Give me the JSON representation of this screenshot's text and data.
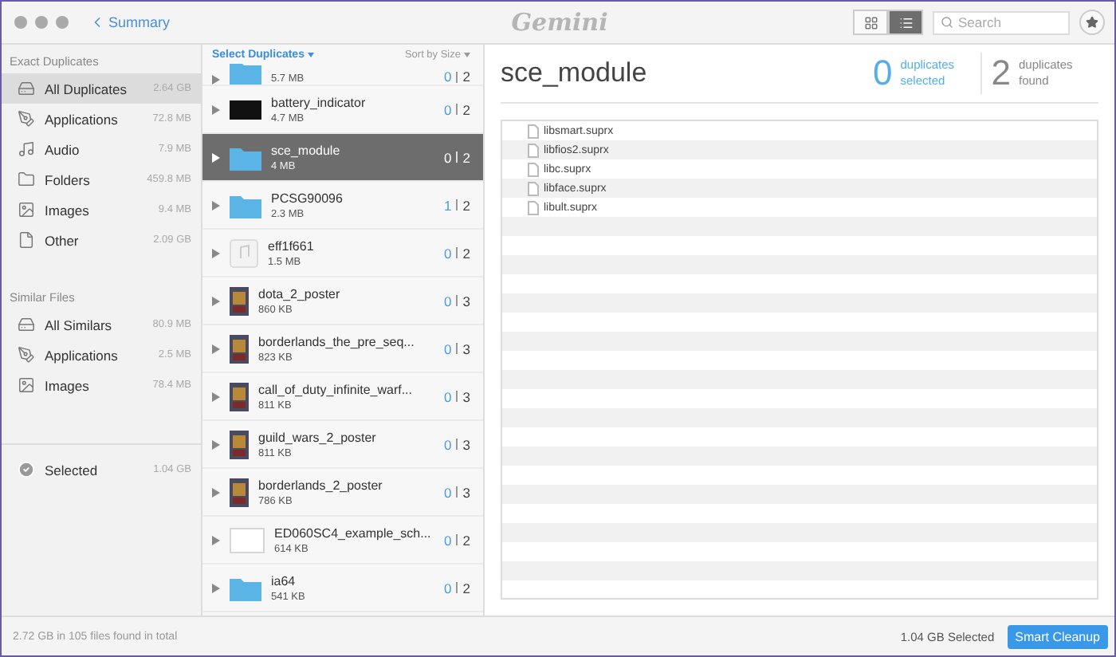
{
  "window": {
    "back": "Summary",
    "logo": "Gemini"
  },
  "toolbar": {
    "views": [
      {
        "kind": "grid",
        "selected": false
      },
      {
        "kind": "list",
        "selected": true
      }
    ],
    "search": {
      "placeholder": "Search"
    }
  },
  "sidebar": {
    "sections": [
      {
        "title": "Exact Duplicates",
        "items": [
          {
            "kind": "drive",
            "label": "All Duplicates",
            "size": "2.64 GB",
            "selected": true
          },
          {
            "kind": "apps",
            "label": "Applications",
            "size": "72.8 MB",
            "selected": false
          },
          {
            "kind": "audio",
            "label": "Audio",
            "size": "7.9 MB",
            "selected": false
          },
          {
            "kind": "folder",
            "label": "Folders",
            "size": "459.8 MB",
            "selected": false
          },
          {
            "kind": "images",
            "label": "Images",
            "size": "9.4 MB",
            "selected": false
          },
          {
            "kind": "other",
            "label": "Other",
            "size": "2.09 GB",
            "selected": false
          }
        ]
      },
      {
        "title": "Similar Files",
        "items": [
          {
            "kind": "drive",
            "label": "All Similars",
            "size": "80.9 MB",
            "selected": false
          },
          {
            "kind": "apps",
            "label": "Applications",
            "size": "2.5 MB",
            "selected": false
          },
          {
            "kind": "images",
            "label": "Images",
            "size": "78.4 MB",
            "selected": false
          }
        ]
      }
    ],
    "selected": {
      "label": "Selected",
      "size": "1.04 GB"
    }
  },
  "list": {
    "select": "Select Duplicates",
    "sort": "Sort by Size",
    "rows": [
      {
        "kind": "folder",
        "size": "5.7 MB",
        "count": "0",
        "total": "2",
        "selected": false
      },
      {
        "kind": "dark",
        "name": "battery_indicator",
        "size": "4.7 MB",
        "count": "0",
        "total": "2",
        "selected": false
      },
      {
        "kind": "folder",
        "name": "sce_module",
        "size": "4 MB",
        "count": "0",
        "total": "2",
        "selected": true
      },
      {
        "kind": "folder",
        "name": "PCSG90096",
        "size": "2.3 MB",
        "count": "1",
        "total": "2",
        "selected": false
      },
      {
        "kind": "music",
        "name": "eff1f661",
        "size": "1.5 MB",
        "count": "0",
        "total": "2",
        "selected": false
      },
      {
        "kind": "poster",
        "name": "dota_2_poster",
        "size": "860 KB",
        "count": "0",
        "total": "3",
        "selected": false
      },
      {
        "kind": "poster",
        "name": "borderlands_the_pre_seq...",
        "size": "823 KB",
        "count": "0",
        "total": "3",
        "selected": false
      },
      {
        "kind": "poster",
        "name": "call_of_duty_infinite_warf...",
        "size": "811 KB",
        "count": "0",
        "total": "3",
        "selected": false
      },
      {
        "kind": "poster",
        "name": "guild_wars_2_poster",
        "size": "811 KB",
        "count": "0",
        "total": "3",
        "selected": false
      },
      {
        "kind": "poster",
        "name": "borderlands_2_poster",
        "size": "786 KB",
        "count": "0",
        "total": "3",
        "selected": false
      },
      {
        "kind": "blank",
        "name": "ED060SC4_example_sch...",
        "size": "614 KB",
        "count": "0",
        "total": "2",
        "selected": false
      },
      {
        "kind": "folder",
        "name": "ia64",
        "size": "541 KB",
        "count": "0",
        "total": "2",
        "selected": false
      }
    ]
  },
  "detail": {
    "title": "sce_module",
    "stats": [
      {
        "kind": "selected",
        "number": "0",
        "label": "duplicates selected"
      },
      {
        "kind": "found",
        "number": "2",
        "label": "duplicates found"
      }
    ],
    "files": [
      "libsmart.suprx",
      "libfios2.suprx",
      "libc.suprx",
      "libface.suprx",
      "libult.suprx"
    ]
  },
  "status_bar": {
    "summary": "2.72 GB in 105 files found in total",
    "selected": "1.04 GB Selected",
    "button": "Smart Cleanup"
  }
}
